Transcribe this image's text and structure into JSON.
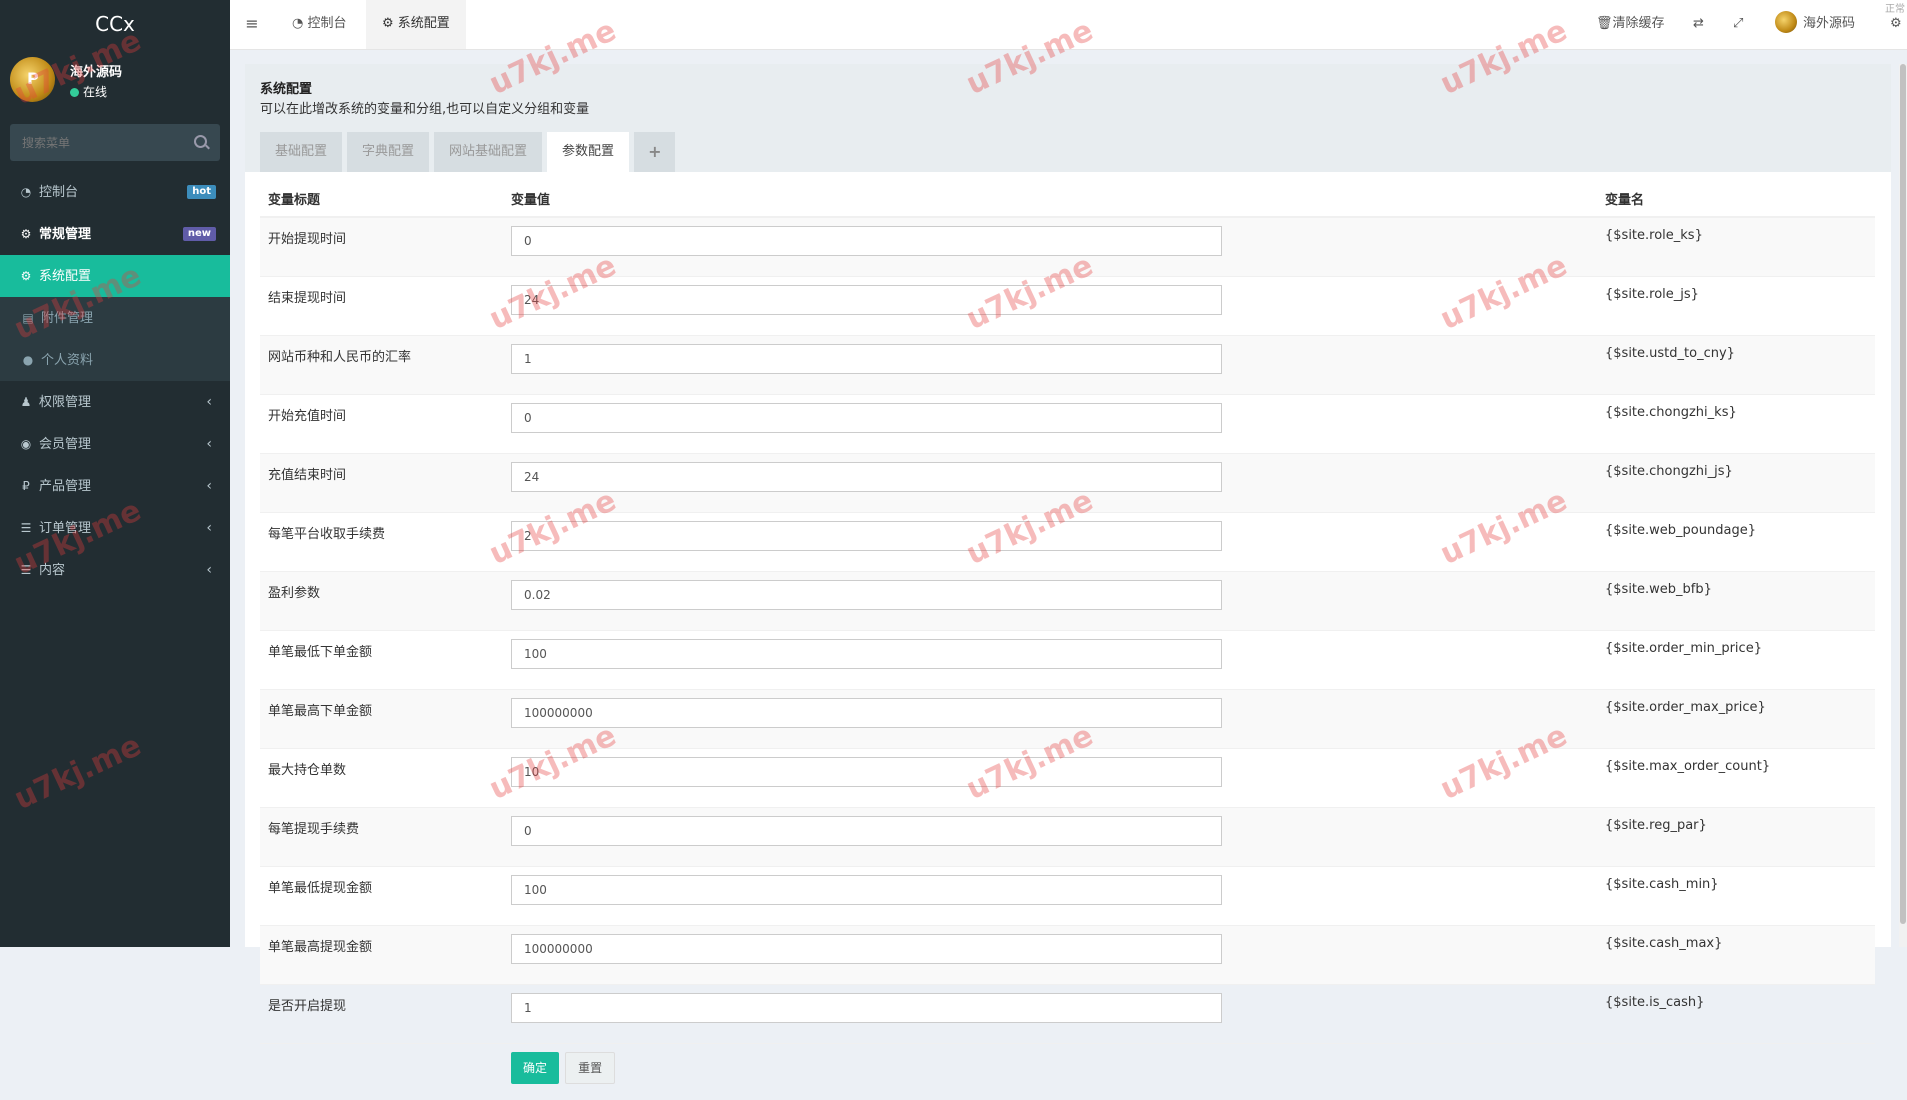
{
  "sidebar": {
    "logo": "CCx",
    "user": {
      "name": "海外源码",
      "status": "在线"
    },
    "search": {
      "placeholder": "搜索菜单"
    },
    "items": [
      {
        "label": "控制台",
        "badge": "hot"
      },
      {
        "label": "常规管理",
        "badge": "new"
      },
      {
        "label": "系统配置"
      },
      {
        "label": "附件管理"
      },
      {
        "label": "个人资料"
      },
      {
        "label": "权限管理"
      },
      {
        "label": "会员管理"
      },
      {
        "label": "产品管理"
      },
      {
        "label": "订单管理"
      },
      {
        "label": "内容"
      }
    ]
  },
  "topbar": {
    "tabs": [
      {
        "label": "控制台"
      },
      {
        "label": "系统配置"
      }
    ],
    "clear_cache": "清除缓存",
    "user_name": "海外源码",
    "corner_text": "正常"
  },
  "page": {
    "title": "系统配置",
    "description": "可以在此增改系统的变量和分组,也可以自定义分组和变量",
    "tabs": [
      "基础配置",
      "字典配置",
      "网站基础配置",
      "参数配置",
      "+"
    ],
    "columns": {
      "label": "变量标题",
      "value": "变量值",
      "name": "变量名"
    },
    "rows": [
      {
        "label": "开始提现时间",
        "value": "0",
        "name": "{$site.role_ks}"
      },
      {
        "label": "结束提现时间",
        "value": "24",
        "name": "{$site.role_js}"
      },
      {
        "label": "网站币种和人民币的汇率",
        "value": "1",
        "name": "{$site.ustd_to_cny}"
      },
      {
        "label": "开始充值时间",
        "value": "0",
        "name": "{$site.chongzhi_ks}"
      },
      {
        "label": "充值结束时间",
        "value": "24",
        "name": "{$site.chongzhi_js}"
      },
      {
        "label": "每笔平台收取手续费",
        "value": "2",
        "name": "{$site.web_poundage}"
      },
      {
        "label": "盈利参数",
        "value": "0.02",
        "name": "{$site.web_bfb}"
      },
      {
        "label": "单笔最低下单金额",
        "value": "100",
        "name": "{$site.order_min_price}"
      },
      {
        "label": "单笔最高下单金额",
        "value": "100000000",
        "name": "{$site.order_max_price}"
      },
      {
        "label": "最大持仓单数",
        "value": "10",
        "name": "{$site.max_order_count}"
      },
      {
        "label": "每笔提现手续费",
        "value": "0",
        "name": "{$site.reg_par}"
      },
      {
        "label": "单笔最低提现金额",
        "value": "100",
        "name": "{$site.cash_min}"
      },
      {
        "label": "单笔最高提现金额",
        "value": "100000000",
        "name": "{$site.cash_max}"
      },
      {
        "label": "是否开启提现",
        "value": "1",
        "name": "{$site.is_cash}"
      }
    ],
    "buttons": {
      "submit": "确定",
      "reset": "重置"
    }
  },
  "watermark": "u7kj.me",
  "colors": {
    "accent": "#18bc9c",
    "sidebar_bg": "#222d32"
  }
}
